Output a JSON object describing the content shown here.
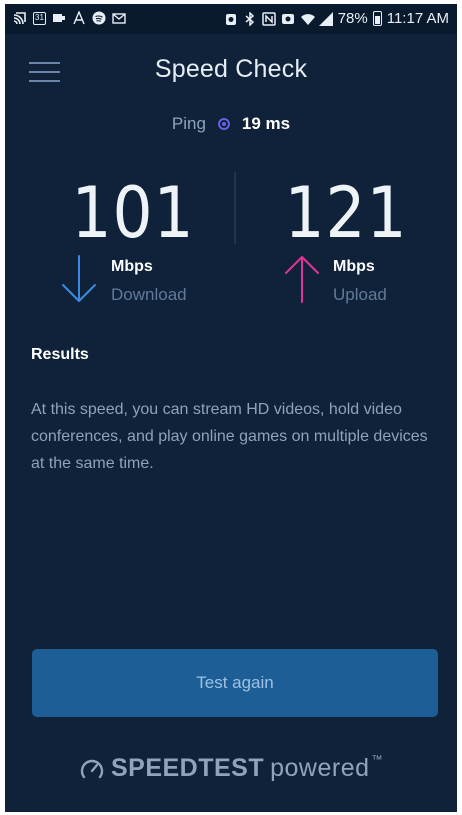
{
  "status_bar": {
    "battery": "78%",
    "time": "11:17 AM",
    "calendar_day": "31",
    "left_icons": [
      "cast-icon",
      "calendar-icon",
      "message-icon",
      "font-icon",
      "spotify-icon",
      "mail-icon"
    ],
    "right_icons": [
      "alarm-icon",
      "bluetooth-icon",
      "nfc-icon",
      "sync-icon",
      "wifi-icon",
      "signal-icon",
      "battery-icon"
    ],
    "battery_level": 0.78
  },
  "header": {
    "title": "Speed Check",
    "menu_icon": "hamburger-menu-icon"
  },
  "ping": {
    "label": "Ping",
    "value": "19 ms",
    "accent": "#6d5ce6"
  },
  "download": {
    "value": "101",
    "unit": "Mbps",
    "label": "Download",
    "color": "#3a8be0"
  },
  "upload": {
    "value": "121",
    "unit": "Mbps",
    "label": "Upload",
    "color": "#e0349a"
  },
  "results": {
    "heading": "Results",
    "body": "At this speed, you can stream HD videos, hold video conferences, and play online games on multiple devices at the same time."
  },
  "actions": {
    "test_again_label": "Test again"
  },
  "footer": {
    "brand": "SPEEDTEST",
    "suffix": "powered",
    "trademark": "™"
  },
  "colors": {
    "background": "#0f2239",
    "button": "#1d5e97"
  }
}
